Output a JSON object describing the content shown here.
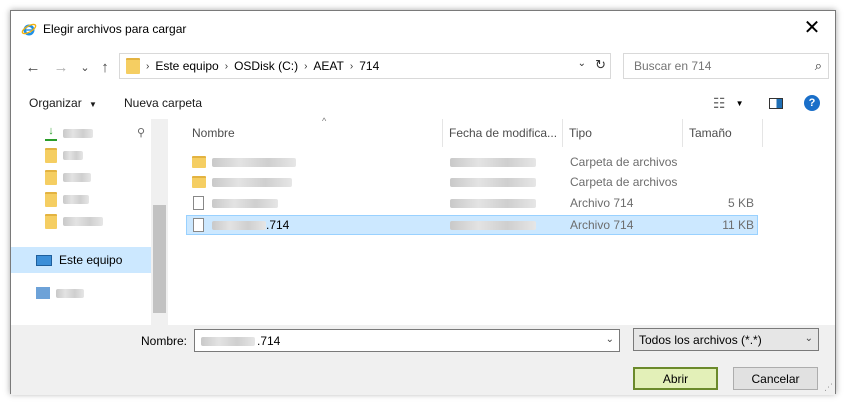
{
  "window": {
    "title": "Elegir archivos para cargar",
    "close_glyph": "✕"
  },
  "nav": {
    "back": "←",
    "forward": "→",
    "recent": "⌄",
    "up": "↑"
  },
  "address": {
    "crumbs": [
      "Este equipo",
      "OSDisk (C:)",
      "AEAT",
      "714"
    ],
    "dropdown": "⌄",
    "refresh": "↻"
  },
  "search": {
    "placeholder": "Buscar en 714",
    "icon": "⌕"
  },
  "toolbar": {
    "organize": "Organizar",
    "new_folder": "Nueva carpeta",
    "view_glyph": "☷",
    "pane_glyph": "▭",
    "help": "?"
  },
  "sidebar": {
    "this_pc": "Este equipo"
  },
  "columns": {
    "name": "Nombre",
    "date": "Fecha de modifica...",
    "type": "Tipo",
    "size": "Tamaño"
  },
  "files": [
    {
      "type": "Carpeta de archivos",
      "size": ""
    },
    {
      "type": "Carpeta de archivos",
      "size": ""
    },
    {
      "type": "Archivo 714",
      "size": "5 KB"
    },
    {
      "name_suffix": ".714",
      "type": "Archivo 714",
      "size": "11 KB"
    }
  ],
  "footer": {
    "name_label": "Nombre:",
    "name_suffix": ".714",
    "filter": "Todos los archivos (*.*)",
    "open": "Abrir",
    "cancel": "Cancelar"
  },
  "colors": {
    "selection": "#cce8ff",
    "folder": "#f5ce62",
    "primary_border": "#6b8a2b"
  }
}
